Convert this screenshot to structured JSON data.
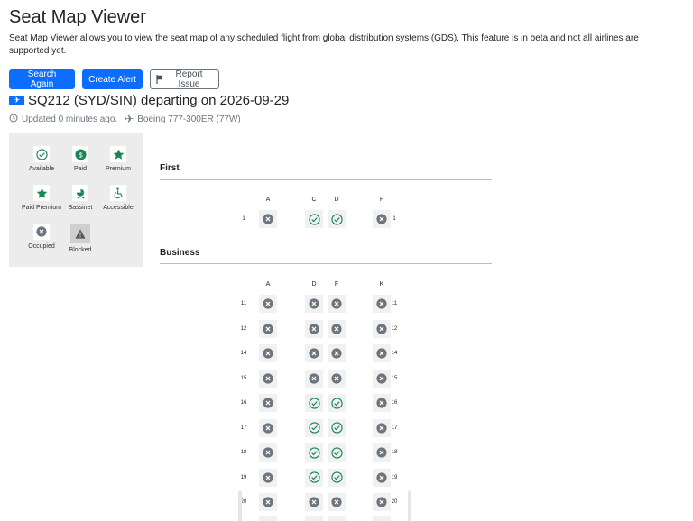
{
  "header": {
    "title": "Seat Map Viewer",
    "description": "Seat Map Viewer allows you to view the seat map of any scheduled flight from global distribution systems (GDS). This feature is in beta and not all airlines are supported yet."
  },
  "actions": {
    "search_again": "Search Again",
    "create_alert": "Create Alert",
    "report_issue": "Report Issue"
  },
  "flight": {
    "heading": "SQ212 (SYD/SIN) departing on 2026-09-29",
    "updated": "Updated 0 minutes ago.",
    "aircraft": "Boeing 777-300ER (77W)"
  },
  "legend": [
    {
      "key": "available",
      "label": "Available"
    },
    {
      "key": "paid",
      "label": "Paid"
    },
    {
      "key": "premium",
      "label": "Premium"
    },
    {
      "key": "paid_premium",
      "label": "Paid Premium"
    },
    {
      "key": "bassinet",
      "label": "Bassinet"
    },
    {
      "key": "accessible",
      "label": "Accessible"
    },
    {
      "key": "occupied",
      "label": "Occupied"
    },
    {
      "key": "blocked",
      "label": "Blocked"
    }
  ],
  "colors": {
    "primary": "#0d6efd",
    "available_green": "#198754",
    "occupied_gray": "#6c757d"
  },
  "cabins": [
    {
      "name": "First",
      "columns": [
        "A",
        "C",
        "D",
        "F"
      ],
      "rows": [
        {
          "num": "1",
          "seats": [
            "occupied",
            "available",
            "available",
            "occupied"
          ]
        }
      ]
    },
    {
      "name": "Business",
      "columns": [
        "A",
        "D",
        "F",
        "K"
      ],
      "rows": [
        {
          "num": "11",
          "seats": [
            "occupied",
            "occupied",
            "occupied",
            "occupied"
          ]
        },
        {
          "num": "12",
          "seats": [
            "occupied",
            "occupied",
            "occupied",
            "occupied"
          ]
        },
        {
          "num": "14",
          "seats": [
            "occupied",
            "occupied",
            "occupied",
            "occupied"
          ]
        },
        {
          "num": "15",
          "seats": [
            "occupied",
            "occupied",
            "occupied",
            "occupied"
          ]
        },
        {
          "num": "16",
          "seats": [
            "occupied",
            "available",
            "available",
            "occupied"
          ]
        },
        {
          "num": "17",
          "seats": [
            "occupied",
            "available",
            "available",
            "occupied"
          ]
        },
        {
          "num": "18",
          "seats": [
            "occupied",
            "available",
            "available",
            "occupied"
          ]
        },
        {
          "num": "19",
          "seats": [
            "occupied",
            "available",
            "available",
            "occupied"
          ]
        },
        {
          "num": "20",
          "seats": [
            "occupied",
            "occupied",
            "occupied",
            "occupied"
          ]
        }
      ]
    }
  ]
}
